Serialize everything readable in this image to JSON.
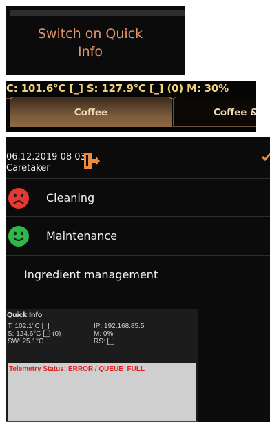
{
  "quick_info_toggle": {
    "label_line1": "Switch on Quick",
    "label_line2": "Info"
  },
  "status_bar": {
    "text": "C: 101.6°C [_] S: 127.9°C [_] (0)  M: 30%"
  },
  "tabs": [
    {
      "label": "Coffee"
    },
    {
      "label": "Coffee &"
    }
  ],
  "header": {
    "datetime": "06.12.2019 08 03",
    "role": "Caretaker"
  },
  "menu": {
    "items": [
      {
        "label": "Cleaning",
        "status": "bad",
        "icon": "sad-face-icon"
      },
      {
        "label": "Maintenance",
        "status": "good",
        "icon": "smiley-face-icon"
      },
      {
        "label": "Ingredient management"
      }
    ]
  },
  "quick_info": {
    "title": "Quick Info",
    "left": [
      "T: 102.1°C [_]",
      "S: 124.6°C [_] (0)",
      "SW: 25.1°C"
    ],
    "right": [
      "IP: 192.168.85.5",
      "M: 0%",
      "RS: [_]"
    ],
    "telemetry": "Telemetry Status: ERROR / QUEUE_FULL"
  },
  "colors": {
    "accent": "#e0956a",
    "status_text": "#f2d27a",
    "sad": "#e53935",
    "happy": "#2db84a",
    "error": "#e02020"
  }
}
